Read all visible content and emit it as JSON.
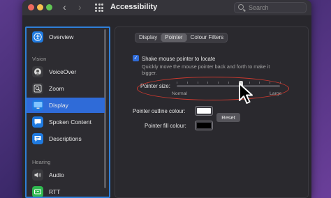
{
  "window": {
    "title": "Accessibility"
  },
  "search": {
    "placeholder": "Search"
  },
  "sidebar": {
    "sections": {
      "vision": "Vision",
      "hearing": "Hearing"
    },
    "items": [
      {
        "label": "Overview",
        "icon": "accessibility-icon",
        "color": "#1f7ae0"
      },
      {
        "label": "VoiceOver",
        "icon": "voiceover-icon",
        "color": "#3a3a3e"
      },
      {
        "label": "Zoom",
        "icon": "zoom-icon",
        "color": "#3a3a3e"
      },
      {
        "label": "Display",
        "icon": "display-icon",
        "color": "#1f7ae0",
        "selected": true
      },
      {
        "label": "Spoken Content",
        "icon": "speech-bubble-icon",
        "color": "#1f7ae0"
      },
      {
        "label": "Descriptions",
        "icon": "descriptions-icon",
        "color": "#1f7ae0"
      },
      {
        "label": "Audio",
        "icon": "speaker-icon",
        "color": "#3a3a3e"
      },
      {
        "label": "RTT",
        "icon": "rtt-icon",
        "color": "#2fb84f"
      }
    ]
  },
  "tabs": [
    {
      "label": "Display",
      "active": false
    },
    {
      "label": "Pointer",
      "active": true
    },
    {
      "label": "Colour Filters",
      "active": false
    }
  ],
  "pointer": {
    "shake_label": "Shake mouse pointer to locate",
    "shake_checked": true,
    "shake_desc_line1": "Quickly move the mouse pointer back and forth to make it",
    "shake_desc_line2": "bigger.",
    "size_label": "Pointer size:",
    "size_min_label": "Normal",
    "size_max_label": "Large",
    "size_value": 0.62,
    "outline_label": "Pointer outline colour:",
    "outline_color": "#ffffff",
    "fill_label": "Pointer fill colour:",
    "fill_color": "#000000",
    "reset_label": "Reset"
  }
}
